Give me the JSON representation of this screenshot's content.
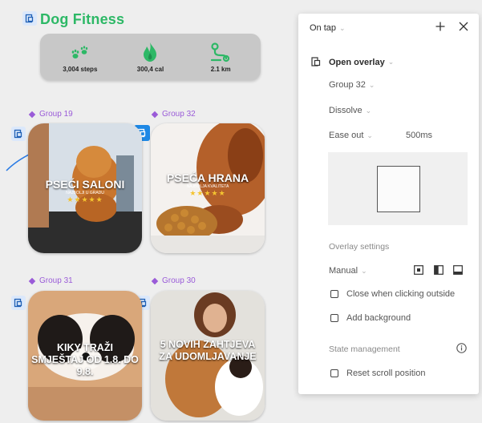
{
  "canvas": {
    "app_title": "Dog Fitness",
    "stats": [
      {
        "icon": "paw-icon",
        "value": "3,004 steps"
      },
      {
        "icon": "flame-icon",
        "value": "300,4 cal"
      },
      {
        "icon": "route-icon",
        "value": "2.1 km"
      }
    ],
    "groups": [
      {
        "label": "Group 19",
        "title": "PSEĆI SALONI",
        "subtitle": "NAJBOLJI U GRADU",
        "stars": "★★★★★"
      },
      {
        "label": "Group 32",
        "title": "PSEĆA HRANA",
        "subtitle": "NAJBOLJA KVALITETA",
        "stars": "★★★★★"
      },
      {
        "label": "Group 31",
        "title": "KIKY TRAŽI SMJEŠTAJ OD 1.8. DO 9.8."
      },
      {
        "label": "Group 30",
        "title": "5 NOVIH ZAHTJEVA ZA UDOMLJAVANJE"
      }
    ],
    "colors": {
      "accent_green": "#2db866",
      "group_purple": "#9a5bd8",
      "selection_blue": "#1e88e5"
    }
  },
  "panel": {
    "trigger": "On tap",
    "action": "Open overlay",
    "destination": "Group 32",
    "animation": "Dissolve",
    "easing": "Ease out",
    "duration": "500ms",
    "overlay_settings_heading": "Overlay settings",
    "position": "Manual",
    "close_outside_label": "Close when clicking outside",
    "add_background_label": "Add background",
    "state_heading": "State management",
    "reset_scroll_label": "Reset scroll position"
  }
}
